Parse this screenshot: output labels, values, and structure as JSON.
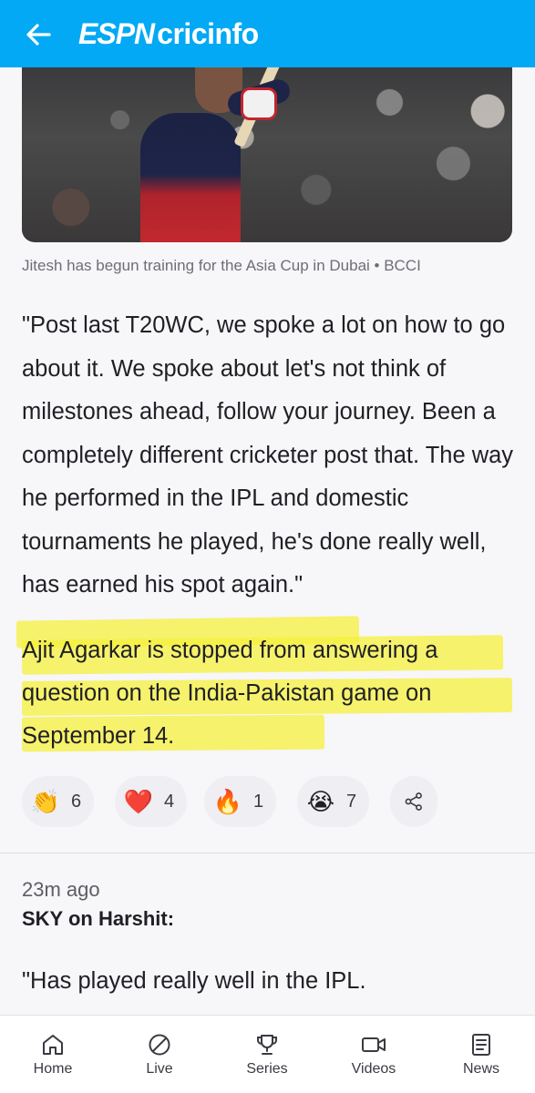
{
  "header": {
    "logo_prefix": "ESPN",
    "logo_suffix": "cricinfo",
    "brand_color": "#03a9f4"
  },
  "article": {
    "image_caption": "Jitesh has begun training for the Asia Cup in Dubai • BCCI",
    "quote": "\"Post last T20WC, we spoke a lot on how to go about it. We spoke about let's not think of milestones ahead, follow your journey. Been a completely different cricketer post that. The way he performed in the IPL and domestic tournaments he played, he's done really well, has earned his spot again.\"",
    "highlighted_note": "Ajit Agarkar is stopped from answering a question on the India-Pakistan game on September 14.",
    "highlight_color": "#f6f03c"
  },
  "reactions": [
    {
      "icon": "clapping-hands-icon",
      "glyph": "👏",
      "count": "6"
    },
    {
      "icon": "red-heart-icon",
      "glyph": "❤️",
      "count": "4"
    },
    {
      "icon": "fire-icon",
      "glyph": "🔥",
      "count": "1"
    },
    {
      "icon": "crying-face-icon",
      "glyph": "😭",
      "count": "7"
    }
  ],
  "next_post": {
    "timestamp": "23m ago",
    "title": "SKY on Harshit:",
    "body": "\"Has played really well in the IPL."
  },
  "bottom_nav": [
    {
      "label": "Home",
      "icon": "home-icon"
    },
    {
      "label": "Live",
      "icon": "live-ball-icon"
    },
    {
      "label": "Series",
      "icon": "trophy-icon"
    },
    {
      "label": "Videos",
      "icon": "video-camera-icon"
    },
    {
      "label": "News",
      "icon": "news-icon"
    }
  ]
}
